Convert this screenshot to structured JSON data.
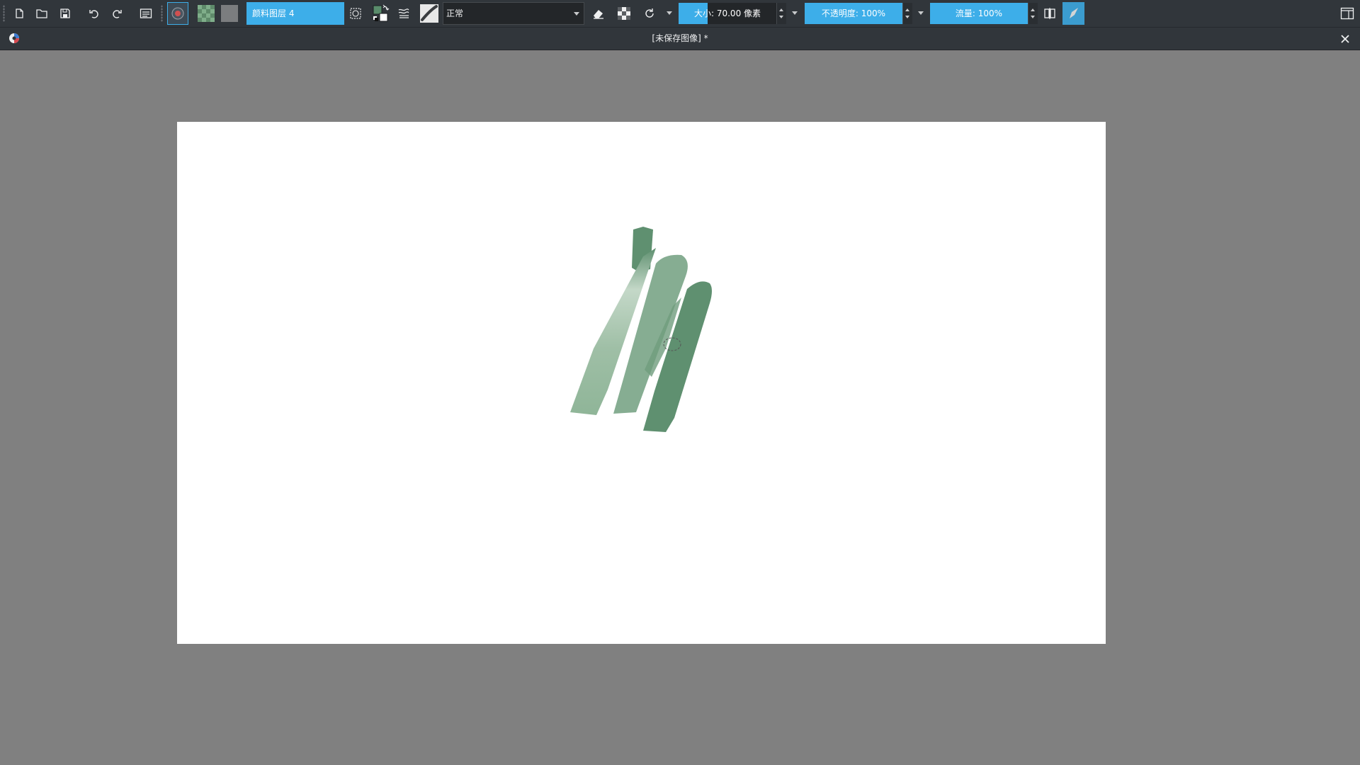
{
  "toolbar": {
    "layer_name": "颜料图层 4",
    "blend_mode": "正常",
    "size": {
      "label": "大小:",
      "value": "70.00 像素",
      "fill_fraction": 0.3
    },
    "opacity": {
      "label": "不透明度:",
      "value": "100%",
      "fill_fraction": 1.0
    },
    "flow": {
      "label": "流量:",
      "value": "100%",
      "fill_fraction": 1.0
    }
  },
  "icons": [
    "new-document-icon",
    "open-document-icon",
    "save-icon",
    "undo-icon",
    "redo-icon",
    "docker-toggle-icon",
    "brush-preset-icon",
    "pattern-icon",
    "gradient-icon",
    "edit-brush-icon",
    "swap-colors-icon",
    "brush-settings-icon",
    "brush-stroke-icon",
    "eraser-icon",
    "alpha-lock-icon",
    "reload-preset-icon",
    "mirror-icon",
    "wrap-around-icon",
    "workspace-icon",
    "close-icon",
    "app-logo"
  ],
  "document": {
    "title": "[未保存图像]  *"
  },
  "colors": {
    "accent": "#3daee9",
    "toolbar_bg": "#31363b",
    "canvas_bg": "#808080",
    "paper": "#ffffff",
    "foreground": "#5a8c6b",
    "background_color": "#ffffff",
    "stroke_light": "#9fbfa6",
    "stroke_mid": "#86ad92",
    "stroke_dark": "#5f9070"
  }
}
